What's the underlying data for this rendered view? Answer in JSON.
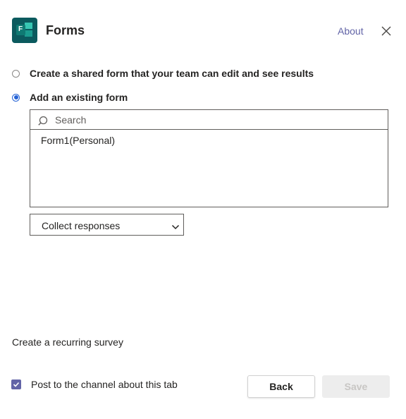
{
  "header": {
    "title": "Forms",
    "about_label": "About",
    "app_icon_letter": "F",
    "icons": [
      "forms-app-icon",
      "close-icon"
    ]
  },
  "options": {
    "create_label": "Create a shared form that your team can edit and see results",
    "existing_label": "Add an existing form",
    "selected": "existing"
  },
  "search": {
    "placeholder": "Search",
    "value": ""
  },
  "forms_list": [
    {
      "label": "Form1(Personal)"
    }
  ],
  "response_select": {
    "value": "Collect responses"
  },
  "footer": {
    "recurring_label": "Create a recurring survey",
    "post_label": "Post to the channel about this tab",
    "post_checked": true,
    "back_label": "Back",
    "save_label": "Save",
    "save_enabled": false
  },
  "colors": {
    "accent": "#6264a7",
    "radio_selected": "#2563d6",
    "disabled_bg": "#ededed",
    "disabled_text": "#c8c6c4"
  }
}
